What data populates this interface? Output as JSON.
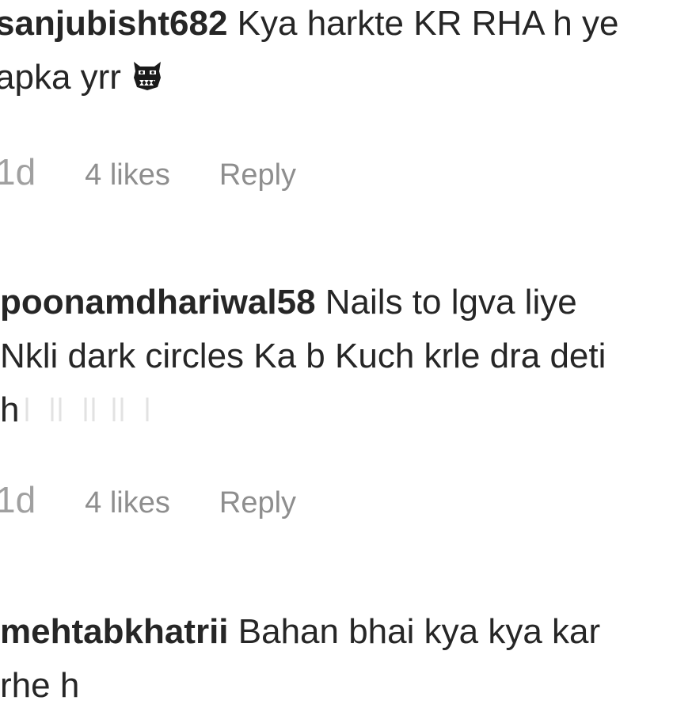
{
  "comments": [
    {
      "username": "sanjubisht682",
      "text": "Kya harkte KR RHA h ye apka yrr",
      "emoji": "ogre-face",
      "time": "1d",
      "likes": "4 likes",
      "reply_label": "Reply"
    },
    {
      "username": "poonamdhariwal58",
      "text": "Nails to lgva liye Nkli dark circles Ka b Kuch krle dra deti h",
      "time": "1d",
      "likes": "4 likes",
      "reply_label": "Reply"
    },
    {
      "username": "mehtabkhatrii",
      "text": "Bahan bhai kya kya kar rhe h"
    }
  ]
}
